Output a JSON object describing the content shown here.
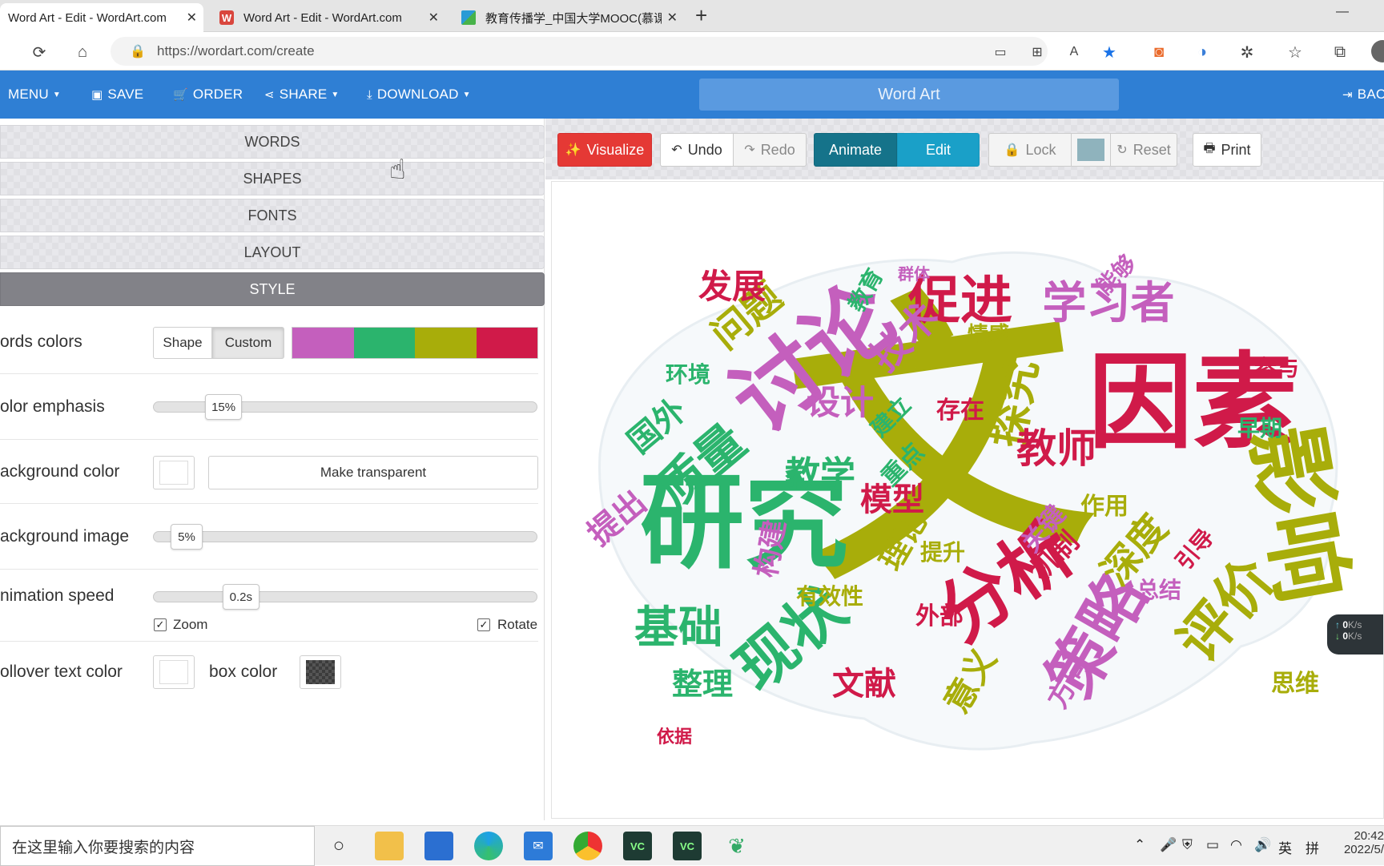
{
  "browser": {
    "tabs": [
      {
        "title": "Word Art - Edit - WordArt.com",
        "active": true
      },
      {
        "title": "Word Art - Edit - WordArt.com",
        "active": false
      },
      {
        "title": "教育传播学_中国大学MOOC(慕课)",
        "active": false
      }
    ],
    "new_tab": "+",
    "minimize": "—",
    "url": "https://wordart.com/create"
  },
  "appbar": {
    "menu": "MENU",
    "save": "SAVE",
    "order": "ORDER",
    "share": "SHARE",
    "download": "DOWNLOAD",
    "title": "Word Art",
    "back": "BAC"
  },
  "sections": [
    "WORDS",
    "SHAPES",
    "FONTS",
    "LAYOUT",
    "STYLE"
  ],
  "style": {
    "words_colors": {
      "label": "ords colors",
      "shape_btn": "Shape",
      "custom_btn": "Custom",
      "swatches": [
        "#c45fbd",
        "#2bb46d",
        "#a8ad0a",
        "#d01a49"
      ]
    },
    "color_emphasis": {
      "label": "olor emphasis",
      "value": "15%",
      "fraction": 0.15
    },
    "background_color": {
      "label": "ackground color",
      "transparent_btn": "Make transparent"
    },
    "background_image": {
      "label": "ackground image",
      "value": "5%",
      "fraction": 0.05
    },
    "animation_speed": {
      "label": "nimation speed",
      "value": "0.2s",
      "fraction": 0.2
    },
    "zoom": {
      "label": "Zoom",
      "checked": true
    },
    "rotate": {
      "label": "Rotate",
      "checked": true
    },
    "rollover": {
      "label": "ollover text color",
      "box_label": "box color"
    }
  },
  "toolbar": {
    "visualize": "Visualize",
    "undo": "Undo",
    "redo": "Redo",
    "animate": "Animate",
    "edit": "Edit",
    "lock": "Lock",
    "reset": "Reset",
    "print": "Print"
  },
  "wordcloud": {
    "words": [
      "文",
      "因素",
      "研究",
      "讨论",
      "影响",
      "分析",
      "现状",
      "策略",
      "评价",
      "促进",
      "质量",
      "学习者",
      "探究",
      "教师",
      "基础",
      "技术",
      "问题",
      "发展",
      "教学",
      "设计",
      "深度",
      "模型",
      "国外",
      "提出",
      "理论",
      "文献",
      "整理",
      "方向",
      "思维",
      "机制",
      "环境",
      "构建",
      "意义",
      "存在",
      "重点",
      "群体",
      "作用",
      "参与",
      "早期",
      "总结",
      "提升",
      "外部",
      "建立",
      "能够",
      "情感",
      "引导",
      "教育",
      "关键",
      "有效性",
      "依据"
    ],
    "colors": [
      "#a8ad0a",
      "#d01a49",
      "#2bb46d",
      "#c45fbd"
    ]
  },
  "speed_widget": {
    "up": "0",
    "down": "0",
    "unit": "K/s"
  },
  "taskbar": {
    "search_placeholder": "在这里输入你要搜索的内容",
    "time": "20:42",
    "date": "2022/5/",
    "ime1": "英",
    "ime2": "拼"
  }
}
